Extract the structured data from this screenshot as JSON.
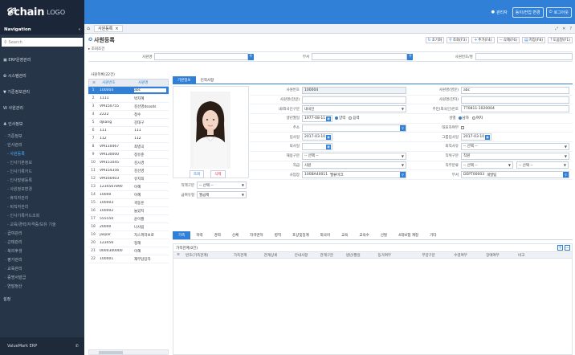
{
  "brand": {
    "name": "chain",
    "suffix": "LOGO"
  },
  "topbar": {
    "user": "관리자",
    "change_label": "동이/컨업 변경",
    "logout_label": "로그아웃"
  },
  "sidebar": {
    "title": "Navigation",
    "search_placeholder": "Search",
    "items": [
      {
        "label": "▣ ERP운영관리",
        "level": "top"
      },
      {
        "label": "✿ 시스템관리",
        "level": "top"
      },
      {
        "label": "▼ 기준정보관리",
        "level": "top"
      },
      {
        "label": "W 사원관리",
        "level": "top"
      },
      {
        "label": "♣ 인사정보",
        "level": "top"
      },
      {
        "label": "· 기준정보",
        "level": "sub"
      },
      {
        "label": "· 인사관리",
        "level": "sub"
      },
      {
        "label": "- 사원등록",
        "level": "sub2",
        "active": true
      },
      {
        "label": "- 인사기본정보",
        "level": "sub2"
      },
      {
        "label": "- 인사기록카드",
        "level": "sub2"
      },
      {
        "label": "- 인사발령등록",
        "level": "sub2"
      },
      {
        "label": "- 사원정보변경",
        "level": "sub2"
      },
      {
        "label": "- 휴직자관리",
        "level": "sub2"
      },
      {
        "label": "- 퇴직자관리",
        "level": "sub2"
      },
      {
        "label": "- 인사기록카드조회",
        "level": "sub2"
      },
      {
        "label": "- 교육/경력/자격증/보유 기술",
        "level": "sub2"
      },
      {
        "label": "· 급여관리",
        "level": "sub"
      },
      {
        "label": "· 근태관리",
        "level": "sub"
      },
      {
        "label": "· 복리후생",
        "level": "sub"
      },
      {
        "label": "· 평가관리",
        "level": "sub"
      },
      {
        "label": "· 교육관리",
        "level": "sub"
      },
      {
        "label": "· 증명서발급",
        "level": "sub"
      },
      {
        "label": "· 연말정산",
        "level": "sub"
      },
      {
        "label": "설정",
        "level": "top"
      }
    ],
    "footer_label": "ValueMark ERP"
  },
  "pagetab": {
    "label": "사원등록"
  },
  "page": {
    "title": "사원등록",
    "breadcrumb": "조회조건",
    "buttons": [
      {
        "label": "초기화",
        "icon": "refresh-icon"
      },
      {
        "label": "조회(F3)",
        "icon": "search-icon"
      },
      {
        "label": "추가(F4)",
        "icon": "plus-icon"
      },
      {
        "label": "삭제(F6)",
        "icon": "minus-icon"
      },
      {
        "label": "저장(F8)",
        "icon": "save-icon"
      },
      {
        "label": "도움말(F1)",
        "icon": "help-icon"
      }
    ]
  },
  "filter": {
    "label1": "사원명",
    "label2": "부서",
    "label3": "사원번호/명"
  },
  "list": {
    "caption": "사원목록(22건)",
    "col1": "사원번호",
    "col2": "사원명",
    "rows": [
      {
        "n": "1",
        "code": "100004",
        "name": "abc"
      },
      {
        "n": "2",
        "code": "1111",
        "name": "박지혜"
      },
      {
        "n": "3",
        "code": "VM150755",
        "name": "김선영dsssds"
      },
      {
        "n": "4",
        "code": "2222",
        "name": "청수"
      },
      {
        "n": "5",
        "code": "djkang",
        "name": "강대구"
      },
      {
        "n": "6",
        "code": "111",
        "name": "111"
      },
      {
        "n": "7",
        "code": "112",
        "name": "112"
      },
      {
        "n": "8",
        "code": "VM110467",
        "name": "최병곡"
      },
      {
        "n": "9",
        "code": "VM130000",
        "name": "정유준"
      },
      {
        "n": "10",
        "code": "VM151045",
        "name": "김시경"
      },
      {
        "n": "11",
        "code": "VM154356",
        "name": "김선영"
      },
      {
        "n": "12",
        "code": "VM160403",
        "name": "유지희"
      },
      {
        "n": "13",
        "code": "1234567890",
        "name": "이혜"
      },
      {
        "n": "14",
        "code": "10000",
        "name": "이혜"
      },
      {
        "n": "15",
        "code": "100003",
        "name": "곽동훈"
      },
      {
        "n": "16",
        "code": "100002",
        "name": "놀았지"
      },
      {
        "n": "17",
        "code": "555550",
        "name": "윤이월"
      },
      {
        "n": "18",
        "code": "20000",
        "name": "나사림"
      },
      {
        "n": "19",
        "code": "jaspar",
        "name": "자스퍼라보로"
      },
      {
        "n": "20",
        "code": "123456",
        "name": "정해"
      },
      {
        "n": "21",
        "code": "0000300000",
        "name": "이혜"
      },
      {
        "n": "22",
        "code": "100001",
        "name": "재무담당자"
      }
    ]
  },
  "detail": {
    "tab1": "기본정보",
    "tab2": "인적사항",
    "photo_search": "조회",
    "photo_delete": "삭제",
    "f_empno_lbl": "사원번호",
    "f_empno": "100004",
    "f_kor_lbl": "사원명(한글)",
    "f_kor": "",
    "f_nat_lbl": "내/외국인구분",
    "f_nat": "내국인",
    "f_birth_lbl": "생년월일",
    "f_birth": "1977-08-11",
    "f_solar": "양력",
    "f_lunar": "음력",
    "f_addr_lbl": "주소",
    "f_addr": "",
    "f_join_lbl": "입사일",
    "f_join": "2017-03-10",
    "f_resign_lbl": "퇴사일",
    "f_resign": "",
    "f_emptype_lbl": "재용구분",
    "f_emptype": "-- 선택 --",
    "f_grade_lbl": "직급",
    "f_grade": "사원",
    "f_dept_lbl": "사업장",
    "f_dept_code": "100BA40011",
    "f_dept": "밸류마크",
    "f_rank_lbl": "직책구분",
    "f_rank": "-- 선택 --",
    "f_payg_lbl": "급여유형",
    "f_payg": "월급제",
    "r_empname_lbl": "사원명(영문)",
    "r_empname": "abc",
    "r_chn_lbl": "사원명(한자)",
    "r_chn": "",
    "r_rrn_lbl": "주민(외국인)번호",
    "r_rrn": "770811-1020004",
    "r_gender_lbl": "성별",
    "r_male": "남자",
    "r_female": "여자",
    "r_foreign_lbl": "대표자여부",
    "r_group_lbl": "그룹입사일",
    "r_group": "2017-03-10",
    "r_retire_lbl": "퇴직사유",
    "r_retire": "-- 선택 --",
    "r_pos_lbl": "직위구분",
    "r_pos": "직원",
    "r_job_lbl": "직무분류",
    "r_job1": "-- 선택 --",
    "r_job2": "-- 선택 --",
    "r_dep_lbl": "부서",
    "r_dep_code": "DEPT00003",
    "r_dep": "개발팀"
  },
  "subtabs": [
    "가족",
    "학력",
    "경력",
    "신체",
    "자격면허",
    "병역",
    "포상및징계",
    "외국어",
    "교육",
    "교육수",
    "선발",
    "4대보험 계정",
    "기타"
  ],
  "subgrid": {
    "caption": "가족관계(0건)",
    "headers": [
      "번호(가족관계)",
      "가족관계",
      "관계상세",
      "안내사항",
      "관계구분",
      "생년/월일",
      "동거여부",
      "부양구분",
      "수령여부",
      "장애여부",
      "비고"
    ]
  }
}
